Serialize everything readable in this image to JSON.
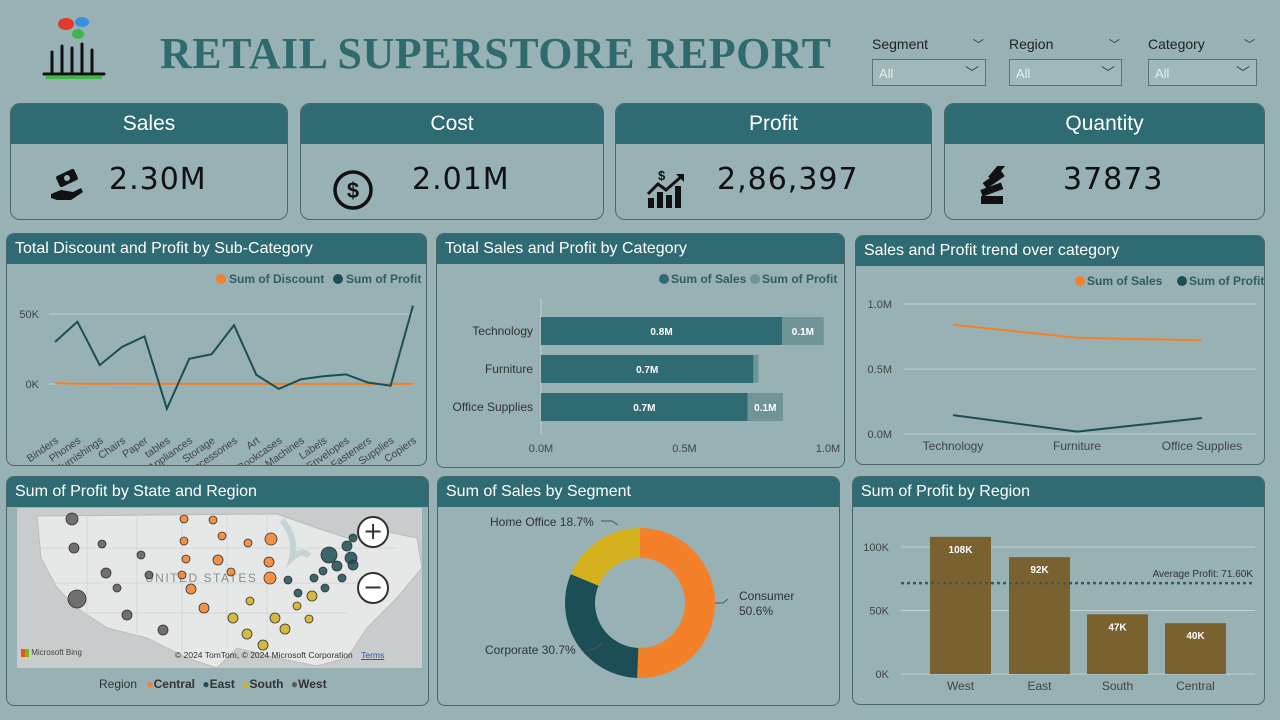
{
  "header": {
    "title": "RETAIL SUPERSTORE REPORT"
  },
  "slicers": [
    {
      "label": "Segment",
      "value": "All"
    },
    {
      "label": "Region",
      "value": "All"
    },
    {
      "label": "Category",
      "value": "All"
    }
  ],
  "kpis": [
    {
      "label": "Sales",
      "value": "2.30M",
      "icon": "money-hand-icon"
    },
    {
      "label": "Cost",
      "value": "2.01M",
      "icon": "dollar-circle-icon"
    },
    {
      "label": "Profit",
      "value": "2,86,397",
      "icon": "growth-chart-icon"
    },
    {
      "label": "Quantity",
      "value": "37873",
      "icon": "stack-icon"
    }
  ],
  "panels": {
    "discount_profit": "Total Discount and Profit by Sub-Category",
    "sales_profit_category": "Total Sales and Profit by Category",
    "trend": "Sales and Profit trend over category",
    "map": "Sum of Profit by State and Region",
    "segment": "Sum of Sales by Segment",
    "region": "Sum of Profit by Region"
  },
  "map": {
    "country_label": "UNITED STATES",
    "attribution": "© 2024 TomTom, © 2024 Microsoft Corporation",
    "terms": "Terms",
    "bing": "Microsoft Bing",
    "legend_title": "Region",
    "legend": [
      {
        "name": "Central",
        "color": "#f4812a"
      },
      {
        "name": "East",
        "color": "#1b4f55"
      },
      {
        "name": "South",
        "color": "#d4b01f"
      },
      {
        "name": "West",
        "color": "#5b5b5b"
      }
    ]
  },
  "chart_data": [
    {
      "type": "line",
      "categories": [
        "Binders",
        "Phones",
        "Furnishings",
        "Chairs",
        "Paper",
        "tables",
        "Appliances",
        "Storage",
        "Accessories",
        "Art",
        "Bookcases",
        "Machines",
        "Labels",
        "Envelopes",
        "Fasteners",
        "Supplies",
        "Copiers"
      ],
      "series": [
        {
          "name": "Sum of Discount",
          "color": "#f4812a",
          "values": [
            600,
            200,
            100,
            200,
            100,
            200,
            100,
            100,
            100,
            100,
            100,
            100,
            50,
            50,
            50,
            50,
            50
          ]
        },
        {
          "name": "Sum of Profit",
          "color": "#1b4f55",
          "values": [
            30000,
            44500,
            13500,
            26500,
            34000,
            -17700,
            18000,
            21300,
            42000,
            6500,
            -3500,
            3400,
            5500,
            6900,
            950,
            -1200,
            56000
          ]
        }
      ],
      "yticks": [
        "50K",
        "0K"
      ],
      "legend_position": "top-right"
    },
    {
      "type": "bar",
      "orientation": "horizontal-stacked",
      "categories": [
        "Technology",
        "Furniture",
        "Office Supplies"
      ],
      "series": [
        {
          "name": "Sum of Sales",
          "color": "#2f6b73",
          "values": [
            0.84,
            0.74,
            0.72
          ],
          "labels": [
            "0.8M",
            "0.7M",
            "0.7M"
          ]
        },
        {
          "name": "Sum of Profit",
          "color": "#6f9598",
          "values": [
            0.145,
            0.018,
            0.123
          ],
          "labels": [
            "0.1M",
            "",
            "0.1M"
          ]
        }
      ],
      "xticks": [
        "0.0M",
        "0.5M",
        "1.0M"
      ],
      "xlim": [
        0,
        1.0
      ],
      "legend_position": "top-right"
    },
    {
      "type": "line",
      "categories": [
        "Technology",
        "Furniture",
        "Office Supplies"
      ],
      "series": [
        {
          "name": "Sum of Sales",
          "color": "#f4812a",
          "values": [
            0.84,
            0.74,
            0.72
          ]
        },
        {
          "name": "Sum of Profit",
          "color": "#1b4f55",
          "values": [
            0.145,
            0.018,
            0.123
          ]
        }
      ],
      "yticks": [
        "1.0M",
        "0.5M",
        "0.0M"
      ],
      "ylim": [
        0,
        1.0
      ],
      "legend_position": "top-right"
    },
    {
      "type": "pie",
      "style": "donut",
      "slices": [
        {
          "name": "Consumer",
          "value": 50.6,
          "color": "#f4812a",
          "label": "Consumer",
          "pct": "50.6%"
        },
        {
          "name": "Corporate",
          "value": 30.7,
          "color": "#1b4f55",
          "label": "Corporate 30.7%"
        },
        {
          "name": "Home Office",
          "value": 18.7,
          "color": "#d4b01f",
          "label": "Home Office 18.7%"
        }
      ]
    },
    {
      "type": "bar",
      "categories": [
        "West",
        "East",
        "South",
        "Central"
      ],
      "values": [
        108,
        92,
        47,
        40
      ],
      "labels": [
        "108K",
        "92K",
        "47K",
        "40K"
      ],
      "color": "#7a6130",
      "yticks": [
        "100K",
        "50K",
        "0K"
      ],
      "ylim": [
        0,
        120
      ],
      "average": {
        "value": 71.6,
        "label": "Average Profit: 71.60K"
      }
    }
  ]
}
